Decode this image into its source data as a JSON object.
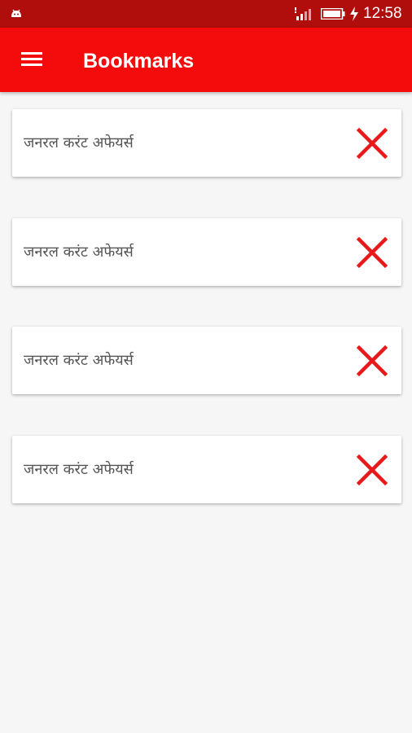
{
  "status_bar": {
    "time": "12:58",
    "icons": [
      "android-icon",
      "signal-icon",
      "battery-icon",
      "charging-icon"
    ]
  },
  "app_bar": {
    "title": "Bookmarks",
    "menu_icon": "hamburger-menu-icon",
    "color": "#f40b0b"
  },
  "bookmarks": [
    {
      "label": "जनरल करंट अफेयर्स",
      "action_icon": "close-icon"
    },
    {
      "label": "जनरल करंट अफेयर्स",
      "action_icon": "close-icon"
    },
    {
      "label": "जनरल करंट अफेयर्स",
      "action_icon": "close-icon"
    },
    {
      "label": "जनरल करंट अफेयर्स",
      "action_icon": "close-icon"
    }
  ],
  "colors": {
    "status_bar": "#b00d0d",
    "accent": "#f40b0b",
    "remove_icon": "#e8191a",
    "background": "#f6f6f6"
  }
}
